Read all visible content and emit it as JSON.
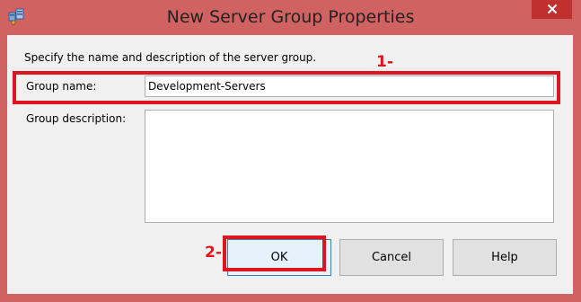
{
  "window": {
    "title": "New Server Group Properties",
    "app_icon": "server-group-icon",
    "close_icon": "close-icon"
  },
  "form": {
    "instruction": "Specify the name and description of the server group.",
    "group_name_label": "Group name:",
    "group_name_value": "Development-Servers",
    "group_description_label": "Group description:",
    "group_description_value": ""
  },
  "buttons": {
    "ok": "OK",
    "cancel": "Cancel",
    "help": "Help"
  },
  "annotations": {
    "step1": "1-",
    "step2": "2-",
    "color": "#E0141E"
  },
  "colors": {
    "frame": "#D16262",
    "client": "#F0F0F0",
    "close_button": "#C0302E"
  }
}
